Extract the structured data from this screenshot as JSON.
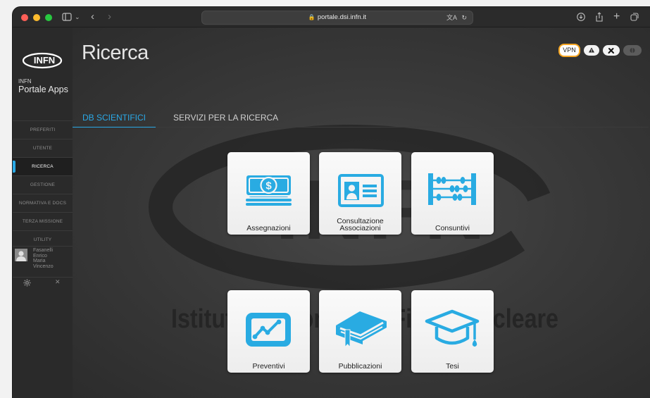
{
  "browser": {
    "url": "portale.dsi.infn.it",
    "traffic_lights": [
      "#fe5f57",
      "#febc2e",
      "#28c840"
    ]
  },
  "sidebar": {
    "logo_text": "INFN",
    "org_small": "INFN",
    "org_big": "Portale Apps",
    "items": [
      {
        "label": "PREFERITI",
        "active": false
      },
      {
        "label": "UTENTE",
        "active": false
      },
      {
        "label": "RICERCA",
        "active": true
      },
      {
        "label": "GESTIONE",
        "active": false
      },
      {
        "label": "NORMATIVA E DOCS",
        "active": false
      },
      {
        "label": "TERZA MISSIONE",
        "active": false
      },
      {
        "label": "UTILITY",
        "active": false
      }
    ],
    "user": {
      "name_lines": [
        "Fasanelli",
        "Enrico",
        "Maria",
        "Vincenzo"
      ]
    },
    "settings_icon": "gear-icon",
    "close_icon": "close-icon"
  },
  "header": {
    "title": "Ricerca",
    "pills": [
      {
        "label": "VPN",
        "icon": null
      },
      {
        "label": "",
        "icon": "warning-icon"
      },
      {
        "label": "",
        "icon": "tools-icon"
      },
      {
        "label": "",
        "icon": "toggle-icon"
      }
    ]
  },
  "tabs": [
    {
      "label": "DB SCIENTIFICI",
      "active": true
    },
    {
      "label": "SERVIZI PER LA RICERCA",
      "active": false
    }
  ],
  "tiles": [
    {
      "label": "Assegnazioni",
      "icon": "money-icon"
    },
    {
      "label": "Consultazione\nAssociazioni",
      "label_lines": [
        "Consultazione",
        "Associazioni"
      ],
      "icon": "id-card-icon"
    },
    {
      "label": "Consuntivi",
      "icon": "abacus-icon"
    },
    {
      "label": "Preventivi",
      "icon": "chart-line-icon"
    },
    {
      "label": "Pubblicazioni",
      "icon": "book-icon"
    },
    {
      "label": "Tesi",
      "icon": "graduation-cap-icon"
    }
  ],
  "watermark": {
    "logo": "INFN",
    "text": "Istituto Nazionale di Fisica Nucleare"
  },
  "colors": {
    "accent": "#29abe2",
    "vpn_border": "#f6a623"
  }
}
